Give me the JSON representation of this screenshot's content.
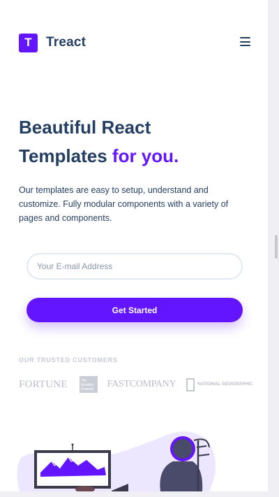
{
  "header": {
    "logo_letter": "T",
    "brand": "Treact",
    "menu_icon": "hamburger-menu-icon"
  },
  "hero": {
    "title_line1": "Beautiful React",
    "title_line2": "Templates",
    "title_accent": "for you.",
    "description": "Our templates are easy to setup, understand and customize. Fully modular components with a variety of pages and components.",
    "email_placeholder": "Your E-mail Address",
    "cta_label": "Get Started"
  },
  "customers": {
    "label": "OUR TRUSTED CUSTOMERS",
    "logos": [
      "FORTUNE",
      "The Weather Channel",
      "FASTCOMPANY",
      "NATIONAL GEOGRAPHIC"
    ]
  },
  "colors": {
    "accent": "#6415ff",
    "heading": "#243e63"
  }
}
